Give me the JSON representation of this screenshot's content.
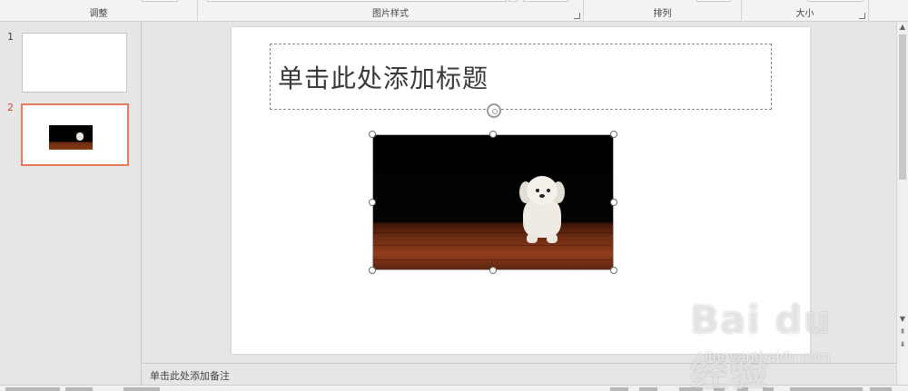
{
  "ribbon": {
    "groups": [
      {
        "label": "调整"
      },
      {
        "label": "图片样式"
      },
      {
        "label": "排列"
      },
      {
        "label": "大小"
      }
    ]
  },
  "thumbnails": [
    {
      "number": "1",
      "selected": false
    },
    {
      "number": "2",
      "selected": true
    }
  ],
  "slide": {
    "title_placeholder": "单击此处添加标题"
  },
  "notes": {
    "placeholder": "单击此处添加备注"
  },
  "watermark": {
    "brand": "Bai du 经验",
    "url": "jingyan.baidu.com"
  },
  "colors": {
    "accent": "#d24726",
    "selection_border": "#e87a5a"
  }
}
